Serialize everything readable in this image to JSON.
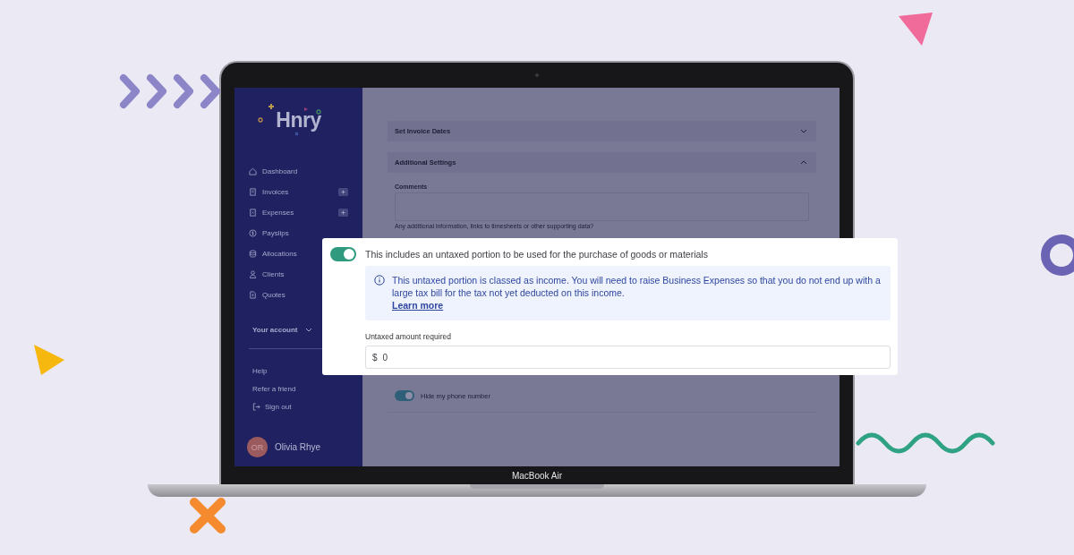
{
  "device_label": "MacBook Air",
  "logo": {
    "text": "Hnry"
  },
  "sidebar": {
    "items": [
      {
        "label": "Dashboard",
        "add": false
      },
      {
        "label": "Invoices",
        "add": true
      },
      {
        "label": "Expenses",
        "add": true
      },
      {
        "label": "Payslips",
        "add": false
      },
      {
        "label": "Allocations",
        "add": false
      },
      {
        "label": "Clients",
        "add": false
      },
      {
        "label": "Quotes",
        "add": false
      }
    ],
    "account": {
      "label": "Your account",
      "expanded": false
    },
    "links": [
      {
        "label": "Help"
      },
      {
        "label": "Refer a friend"
      },
      {
        "label": "Sign out"
      }
    ],
    "user": {
      "initials": "OR",
      "name": "Olivia Rhye"
    }
  },
  "sections": [
    {
      "title": "Set Invoice Dates",
      "expanded": false
    },
    {
      "title": "Additional Settings",
      "expanded": true
    }
  ],
  "comments": {
    "label": "Comments",
    "helper": "Any additional information, links to timesheets or other supporting data?"
  },
  "hide_phone": {
    "label": "Hide my phone number",
    "on": true
  },
  "popup": {
    "toggle_label": "This includes an untaxed portion to be used for the purchase of goods or materials",
    "on": true,
    "info": "This untaxed portion is classed as income. You will need to raise Business Expenses so that you do not end up with a large tax bill for the tax not yet deducted on this income.",
    "link": "Learn more",
    "amount_label": "Untaxed amount required",
    "currency": "$",
    "value": "0"
  }
}
